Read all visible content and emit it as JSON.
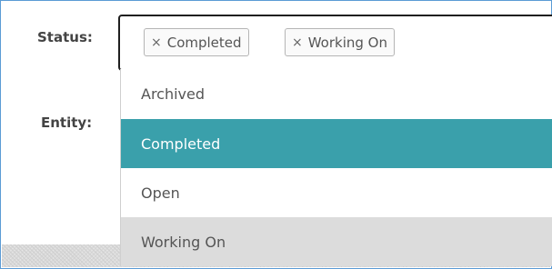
{
  "form": {
    "status_label": "Status:",
    "entity_label": "Entity:"
  },
  "status_select": {
    "selected_tags": [
      {
        "remove_glyph": "×",
        "label": "Completed"
      },
      {
        "remove_glyph": "×",
        "label": "Working On"
      }
    ],
    "options": [
      {
        "label": "Archived",
        "state": "normal"
      },
      {
        "label": "Completed",
        "state": "highlighted"
      },
      {
        "label": "Open",
        "state": "normal"
      },
      {
        "label": "Working On",
        "state": "selected"
      }
    ]
  },
  "colors": {
    "highlight": "#3aa0ab",
    "selected_option_bg": "#dcdcdc",
    "frame_border": "#5b9bd5"
  }
}
